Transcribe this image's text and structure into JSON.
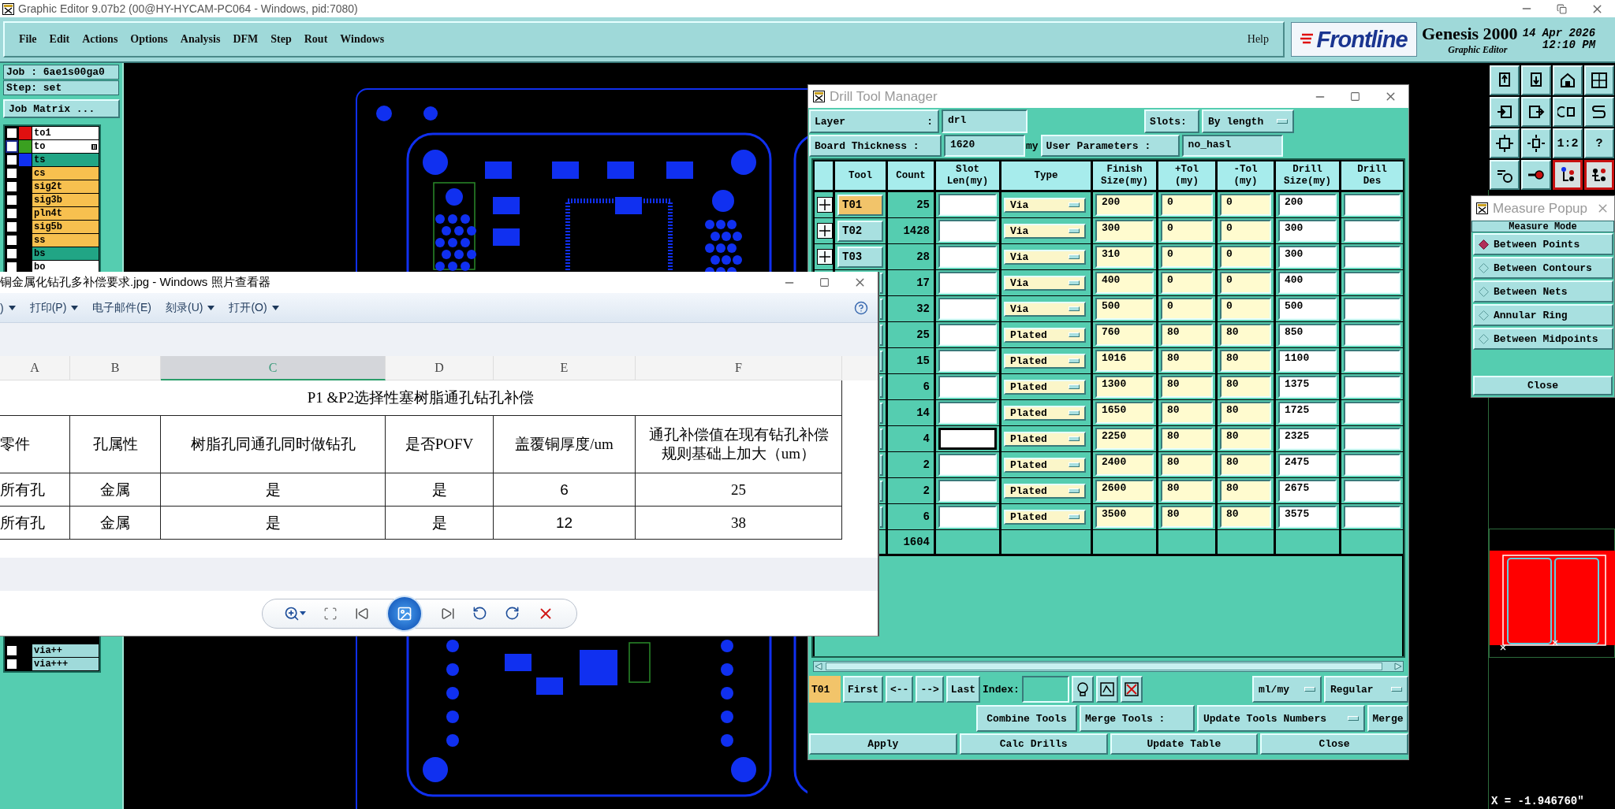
{
  "window": {
    "title": "Graphic Editor 9.07b2 (00@HY-HYCAM-PC064 - Windows, pid:7080)"
  },
  "menu": [
    "File",
    "Edit",
    "Actions",
    "Options",
    "Analysis",
    "DFM",
    "Step",
    "Rout",
    "Windows"
  ],
  "help": "Help",
  "brand": {
    "logo": "Frontline",
    "product": "Genesis 2000",
    "module": "Graphic Editor",
    "date": "14 Apr 2026",
    "time": "12:10 PM"
  },
  "job_panel": {
    "job": "Job : 6ae1s00ga0",
    "step": "Step: set",
    "matrix_button": "Job Matrix ...",
    "layers": [
      {
        "name": "to1",
        "kind": "silk",
        "color": "#e01010",
        "marked": false,
        "checked": false
      },
      {
        "name": "to",
        "kind": "silk",
        "color": "#3aa020",
        "marked": true,
        "checked": false
      },
      {
        "name": "ts",
        "kind": "mask",
        "color": "#1030f0",
        "marked": false,
        "checked": false
      },
      {
        "name": "cs",
        "kind": "signal",
        "marked": false,
        "checked": false
      },
      {
        "name": "sig2t",
        "kind": "signal",
        "marked": false,
        "checked": false
      },
      {
        "name": "sig3b",
        "kind": "signal",
        "marked": false,
        "checked": false
      },
      {
        "name": "pln4t",
        "kind": "signal",
        "marked": false,
        "checked": false
      },
      {
        "name": "sig5b",
        "kind": "signal",
        "marked": false,
        "checked": false
      },
      {
        "name": "ss",
        "kind": "signal",
        "marked": false,
        "checked": false
      },
      {
        "name": "bs",
        "kind": "mask",
        "marked": false,
        "checked": false
      },
      {
        "name": "bo",
        "kind": "silk",
        "marked": false,
        "checked": false
      }
    ],
    "lower_layers": [
      {
        "name": "via++",
        "kind": "drill",
        "marked": false,
        "checked": false
      },
      {
        "name": "via+++",
        "kind": "drill",
        "marked": false,
        "checked": false
      }
    ]
  },
  "icon_panel": {
    "scale_label": "1:2",
    "help_label": "?"
  },
  "measure_popup": {
    "title": "Measure Popup",
    "heading": "Measure Mode",
    "modes": [
      {
        "label": "Between Points",
        "selected": true
      },
      {
        "label": "Between Contours",
        "selected": false
      },
      {
        "label": "Between Nets",
        "selected": false
      },
      {
        "label": "Annular Ring",
        "selected": false
      },
      {
        "label": "Between Midpoints",
        "selected": false
      }
    ],
    "close": "Close"
  },
  "readout": "X = -1.946760\"",
  "drill_manager": {
    "title": "Drill Tool Manager",
    "layer_label": "Layer",
    "colon": ":",
    "layer": "drl",
    "slots_label": "Slots:",
    "slots": "By length",
    "thickness_label": "Board Thickness :",
    "thickness": "1620",
    "thickness_unit": "my",
    "params_label": "User Parameters :",
    "params": "no_hasl",
    "columns": [
      "Tool",
      "Count",
      "Slot\nLen(my)",
      "Type",
      "Finish\nSize(my)",
      "+Tol\n(my)",
      "-Tol\n(my)",
      "Drill\nSize(my)",
      "Drill\nDes"
    ],
    "rows": [
      {
        "tool": "T01",
        "selected": true,
        "focused": false,
        "count": "25",
        "type": "Via",
        "finish": "200",
        "plus_tol": "0",
        "minus_tol": "0",
        "drill_size": "200"
      },
      {
        "tool": "T02",
        "selected": false,
        "focused": false,
        "count": "1428",
        "type": "Via",
        "finish": "300",
        "plus_tol": "0",
        "minus_tol": "0",
        "drill_size": "300"
      },
      {
        "tool": "T03",
        "selected": false,
        "focused": false,
        "count": "28",
        "type": "Via",
        "finish": "310",
        "plus_tol": "0",
        "minus_tol": "0",
        "drill_size": "300"
      },
      {
        "selected": false,
        "focused": false,
        "count": "17",
        "type": "Via",
        "finish": "400",
        "plus_tol": "0",
        "minus_tol": "0",
        "drill_size": "400"
      },
      {
        "selected": false,
        "focused": false,
        "count": "32",
        "type": "Via",
        "finish": "500",
        "plus_tol": "0",
        "minus_tol": "0",
        "drill_size": "500"
      },
      {
        "selected": false,
        "focused": false,
        "count": "25",
        "type": "Plated",
        "finish": "760",
        "plus_tol": "80",
        "minus_tol": "80",
        "drill_size": "850"
      },
      {
        "selected": false,
        "focused": false,
        "count": "15",
        "type": "Plated",
        "finish": "1016",
        "plus_tol": "80",
        "minus_tol": "80",
        "drill_size": "1100"
      },
      {
        "selected": false,
        "focused": false,
        "count": "6",
        "type": "Plated",
        "finish": "1300",
        "plus_tol": "80",
        "minus_tol": "80",
        "drill_size": "1375"
      },
      {
        "selected": false,
        "focused": false,
        "count": "14",
        "type": "Plated",
        "finish": "1650",
        "plus_tol": "80",
        "minus_tol": "80",
        "drill_size": "1725"
      },
      {
        "selected": false,
        "focused": true,
        "count": "4",
        "type": "Plated",
        "finish": "2250",
        "plus_tol": "80",
        "minus_tol": "80",
        "drill_size": "2325"
      },
      {
        "selected": false,
        "focused": false,
        "count": "2",
        "type": "Plated",
        "finish": "2400",
        "plus_tol": "80",
        "minus_tol": "80",
        "drill_size": "2475"
      },
      {
        "selected": false,
        "focused": false,
        "count": "2",
        "type": "Plated",
        "finish": "2600",
        "plus_tol": "80",
        "minus_tol": "80",
        "drill_size": "2675"
      },
      {
        "selected": false,
        "focused": false,
        "count": "6",
        "type": "Plated",
        "finish": "3500",
        "plus_tol": "80",
        "minus_tol": "80",
        "drill_size": "3575"
      }
    ],
    "total": "1604",
    "current_tool": "T01",
    "nav": [
      "First",
      "<--",
      "-->",
      "Last"
    ],
    "index_label": "Index:",
    "units": "ml/my",
    "mode": "Regular",
    "combine": "Combine Tools",
    "merge_label": "Merge Tools :",
    "merge_option": "Update Tools Numbers",
    "merge": "Merge",
    "actions": [
      "Apply",
      "Calc Drills",
      "Update Table",
      "Close"
    ]
  },
  "viewer": {
    "title": "铜金属化钻孔多补偿要求.jpg - Windows 照片查看器",
    "menu": [
      {
        "label": ")",
        "dropdown": true
      },
      {
        "label": "打印(P)",
        "dropdown": true
      },
      {
        "label": "电子邮件(E)",
        "dropdown": false
      },
      {
        "label": "刻录(U)",
        "dropdown": true
      },
      {
        "label": "打开(O)",
        "dropdown": true
      }
    ],
    "sheet": {
      "columns": [
        {
          "label": "A",
          "selected": false
        },
        {
          "label": "B",
          "selected": false
        },
        {
          "label": "C",
          "selected": true
        },
        {
          "label": "D",
          "selected": false
        },
        {
          "label": "E",
          "selected": false
        },
        {
          "label": "F",
          "selected": false
        }
      ],
      "title": "P1 &P2选择性塞树脂通孔钻孔补偿",
      "header": [
        "零件",
        "孔属性",
        "树脂孔同通孔同时做钻孔",
        "是否POFV",
        "盖覆铜厚度/um",
        "通孔补偿值在现有钻孔补偿规则基础上加大（um）"
      ],
      "rows": [
        [
          "所有孔",
          "金属",
          "是",
          "是",
          "6",
          "25"
        ],
        [
          "所有孔",
          "金属",
          "是",
          "是",
          "12",
          "38"
        ]
      ]
    }
  }
}
